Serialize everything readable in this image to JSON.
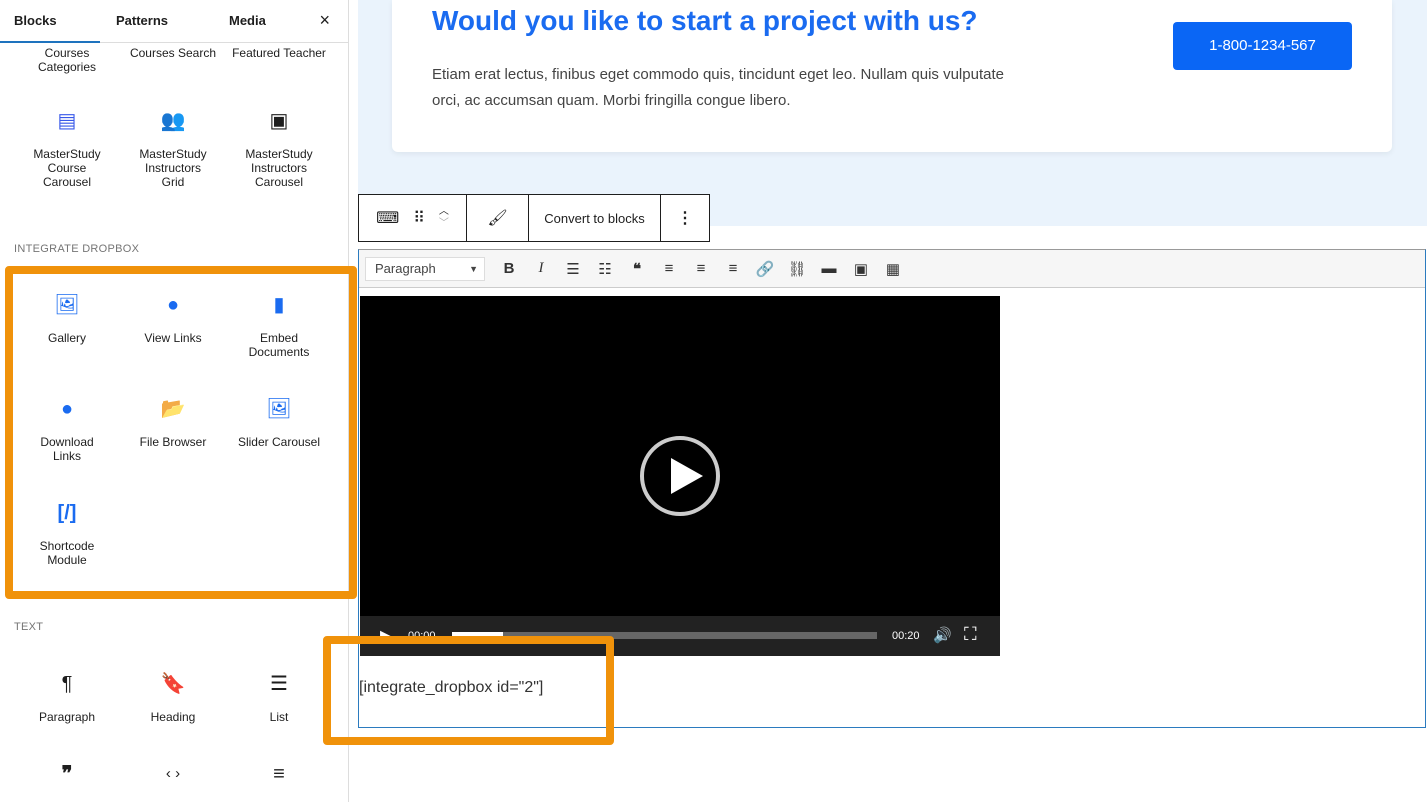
{
  "sidebar": {
    "tabs": [
      "Blocks",
      "Patterns",
      "Media"
    ],
    "close": "×",
    "top_items": [
      "Courses Categories",
      "Courses Search",
      "Featured Teacher"
    ],
    "masterstudy": [
      "MasterStudy Course Carousel",
      "MasterStudy Instructors Grid",
      "MasterStudy Instructors Carousel"
    ],
    "section_dropbox": "INTEGRATE DROPBOX",
    "dropbox": [
      "Gallery",
      "View Links",
      "Embed Documents",
      "Download Links",
      "File Browser",
      "Slider Carousel",
      "Shortcode Module"
    ],
    "section_text": "TEXT",
    "text": [
      "Paragraph",
      "Heading",
      "List"
    ]
  },
  "hero": {
    "title": "Would you like to start a project with us?",
    "body": "Etiam erat lectus, finibus eget commodo quis, tincidunt eget leo. Nullam quis vulputate orci, ac accumsan quam. Morbi fringilla congue libero.",
    "cta": "1-800-1234-567"
  },
  "block_toolbar": {
    "convert": "Convert to blocks"
  },
  "editor": {
    "format": "Paragraph",
    "shortcode": "[integrate_dropbox id=\"2\"]"
  },
  "video": {
    "current": "00:00",
    "duration": "00:20",
    "progress": 0.12
  },
  "colors": {
    "accent": "#1a6bf0",
    "highlight": "#f0920a"
  }
}
